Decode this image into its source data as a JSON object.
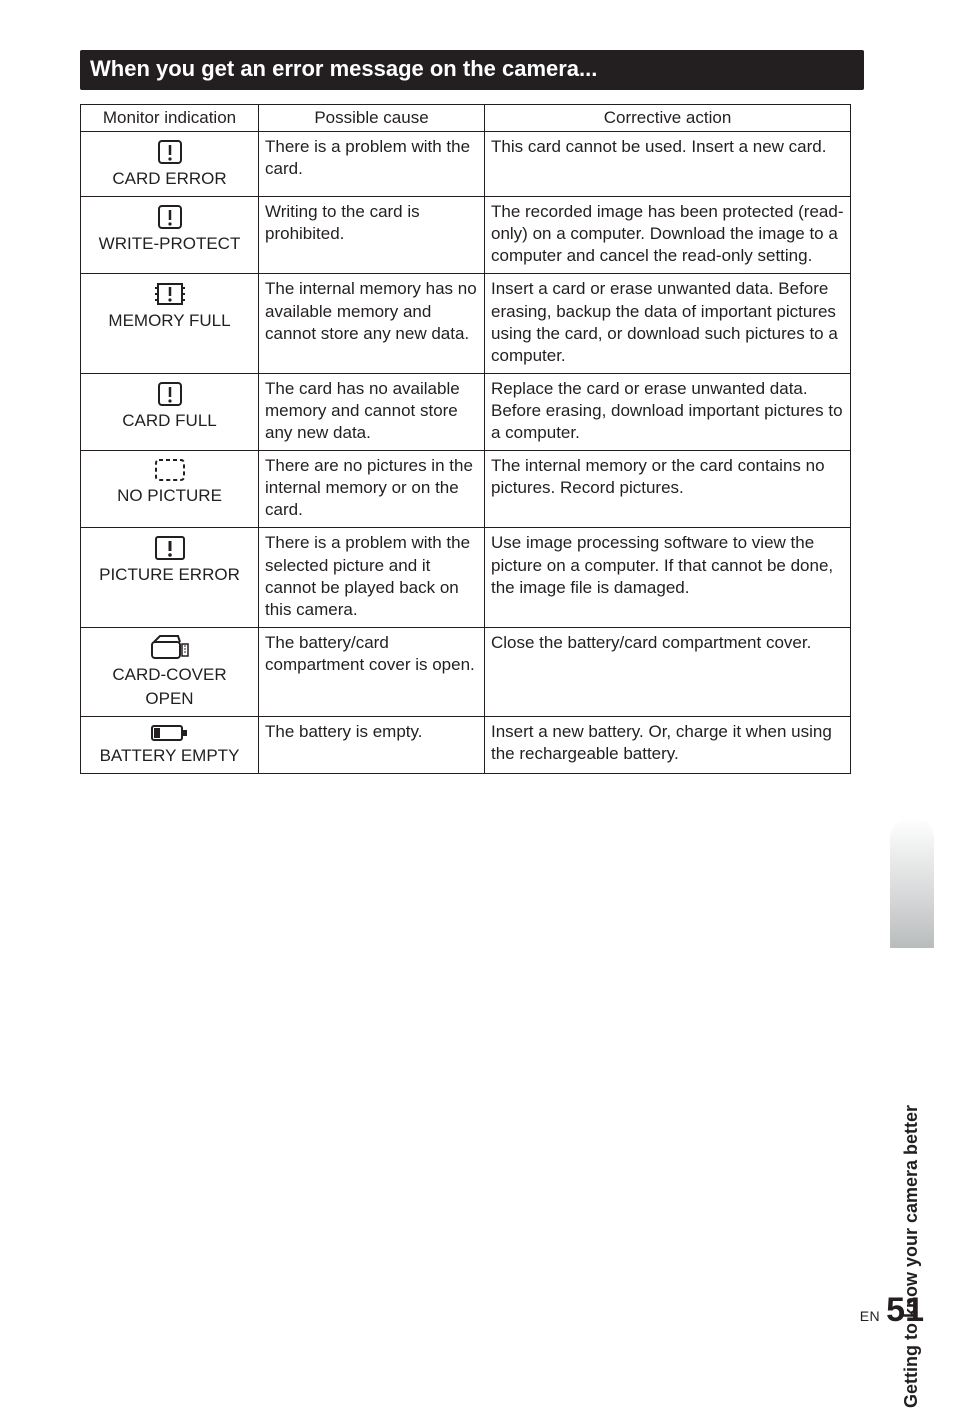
{
  "section_title": "When you get an error message on the camera...",
  "table": {
    "headers": [
      "Monitor indication",
      "Possible cause",
      "Corrective action"
    ],
    "rows": [
      {
        "label": "CARD ERROR",
        "icon": "warn-box-icon",
        "cause": "There is a problem with the card.",
        "correction": "This card cannot be used. Insert a new card."
      },
      {
        "label": "WRITE-PROTECT",
        "icon": "warn-box-icon",
        "cause": "Writing to the card is prohibited.",
        "correction": "The recorded image has been protected (read-only) on a computer. Download the image to a computer and cancel the read-only setting."
      },
      {
        "label": "MEMORY FULL",
        "icon": "memory-bracket-icon",
        "cause": "The internal memory has no available memory and cannot store any new data.",
        "correction": "Insert a card or erase unwanted data. Before erasing, backup the data of important pictures using the card, or download such pictures to a computer."
      },
      {
        "label": "CARD FULL",
        "icon": "warn-box-icon",
        "cause": "The card has no available memory and cannot store any new data.",
        "correction": "Replace the card or erase unwanted data. Before erasing, download important pictures to a computer."
      },
      {
        "label": "NO PICTURE",
        "icon": "dashed-box-icon",
        "cause": "There are no pictures in the internal memory or on the card.",
        "correction": "The internal memory or the card contains no pictures. Record pictures."
      },
      {
        "label": "PICTURE ERROR",
        "icon": "warn-box-solid-icon",
        "cause": "There is a problem with the selected picture and it cannot be played back on this camera.",
        "correction": "Use image processing software to view the picture on a computer. If that cannot be done, the image file is damaged."
      },
      {
        "label1": "CARD-COVER",
        "label2": "OPEN",
        "icon": "card-cover-icon",
        "cause": "The battery/card compartment cover is open.",
        "correction": "Close the battery/card compartment cover."
      },
      {
        "label": "BATTERY EMPTY",
        "icon": "battery-icon",
        "cause": "The battery is empty.",
        "correction": "Insert a new battery. Or, charge it when using the rechargeable battery."
      }
    ]
  },
  "side_tab": "Getting to know your camera better",
  "footer": {
    "lang": "EN",
    "page": "51"
  }
}
